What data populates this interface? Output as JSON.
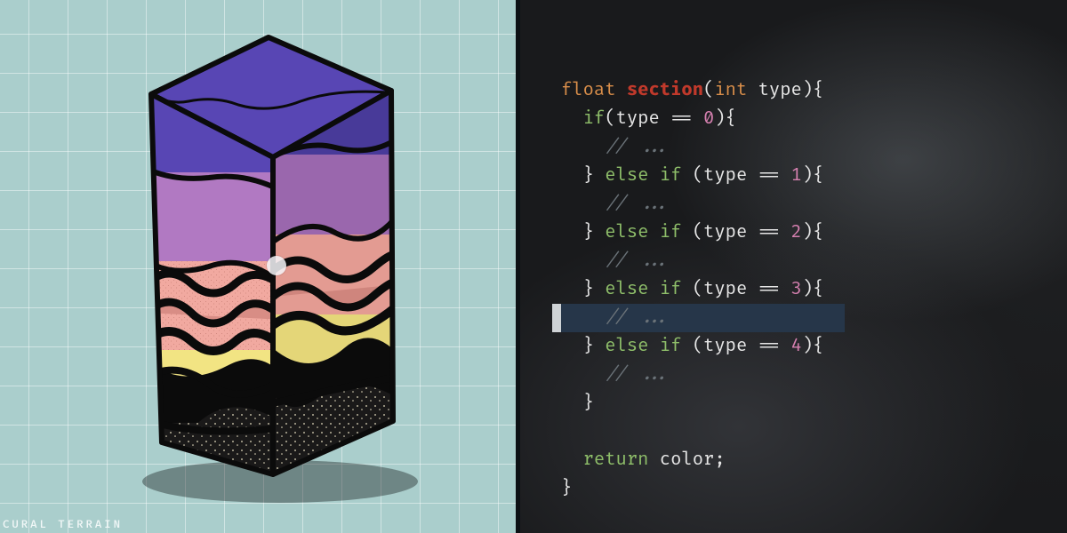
{
  "watermark": "CURAL TERRAIN",
  "layer_colors": {
    "top": "#5846b4",
    "mid": "#b179c2",
    "pink": "#f1a9a0",
    "yellow": "#f2e483",
    "base": "#171616"
  },
  "code": {
    "ret_type": "float",
    "fn_name": "section",
    "param_type": "int",
    "param_name": "type",
    "kw_if": "if",
    "kw_else": "else",
    "kw_return": "return",
    "ret_ident": "color",
    "comment": "// ...",
    "eq": "==",
    "branches": [
      "0",
      "1",
      "2",
      "3",
      "4"
    ],
    "highlighted_branch_index": 3
  }
}
